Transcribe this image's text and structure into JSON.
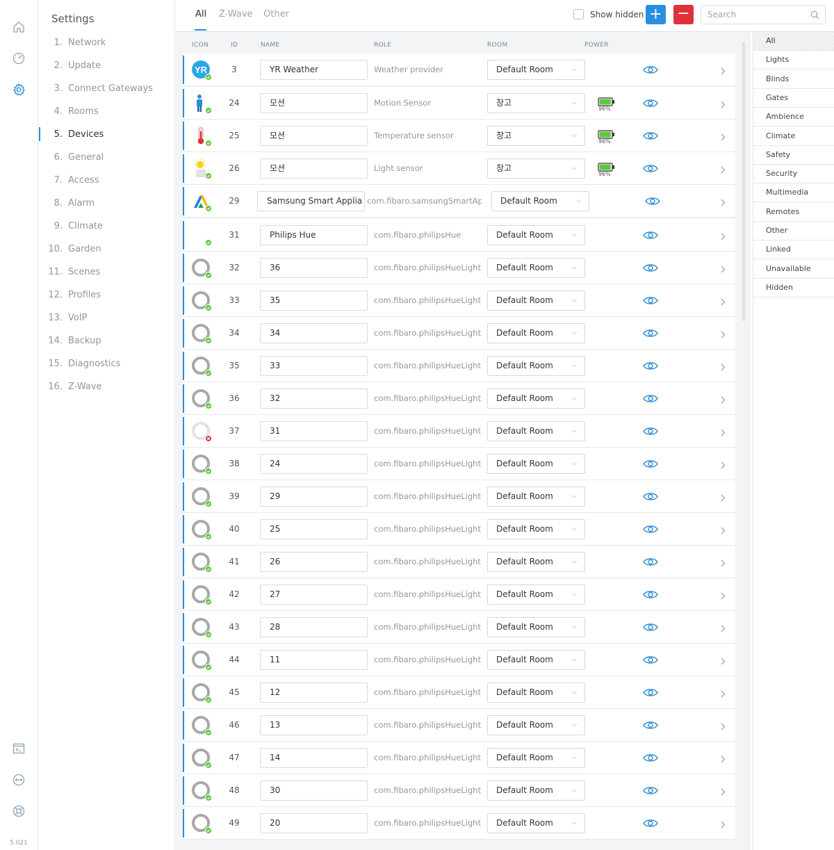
{
  "version": "5.021",
  "sidebar": {
    "title": "Settings",
    "items": [
      {
        "num": "1.",
        "label": "Network"
      },
      {
        "num": "2.",
        "label": "Update"
      },
      {
        "num": "3.",
        "label": "Connect Gateways"
      },
      {
        "num": "4.",
        "label": "Rooms"
      },
      {
        "num": "5.",
        "label": "Devices",
        "active": true
      },
      {
        "num": "6.",
        "label": "General"
      },
      {
        "num": "7.",
        "label": "Access"
      },
      {
        "num": "8.",
        "label": "Alarm"
      },
      {
        "num": "9.",
        "label": "Climate"
      },
      {
        "num": "10.",
        "label": "Garden"
      },
      {
        "num": "11.",
        "label": "Scenes"
      },
      {
        "num": "12.",
        "label": "Profiles"
      },
      {
        "num": "13.",
        "label": "VoIP"
      },
      {
        "num": "14.",
        "label": "Backup"
      },
      {
        "num": "15.",
        "label": "Diagnostics"
      },
      {
        "num": "16.",
        "label": "Z-Wave"
      }
    ]
  },
  "tabs": [
    "All",
    "Z-Wave",
    "Other"
  ],
  "active_tab": "All",
  "toolbar": {
    "show_hidden_label": "Show hidden",
    "add_label": "+",
    "remove_label": "−",
    "search_placeholder": "Search"
  },
  "columns": {
    "icon": "ICON",
    "id": "ID",
    "name": "NAME",
    "role": "ROLE",
    "room": "ROOM",
    "power": "POWER"
  },
  "colors": {
    "accent": "#2d8ad6",
    "add": "#2a8ee0",
    "remove": "#e0303c",
    "ok": "#5cc93a",
    "error": "#e03040"
  },
  "devices": [
    {
      "id": "3",
      "name": "YR Weather",
      "role": "Weather provider",
      "room": "Default Room",
      "icon": "yr-weather-icon",
      "status": "ok"
    },
    {
      "id": "24",
      "name": "모션",
      "role": "Motion Sensor",
      "room": "창고",
      "icon": "motion-sensor-icon",
      "status": "ok",
      "battery": "96%",
      "battery_level": 0.96
    },
    {
      "id": "25",
      "name": "모션",
      "role": "Temperature sensor",
      "room": "창고",
      "icon": "thermometer-icon",
      "status": "ok",
      "battery": "96%",
      "battery_level": 0.96
    },
    {
      "id": "26",
      "name": "모션",
      "role": "Light sensor",
      "room": "창고",
      "icon": "light-sensor-icon",
      "status": "ok",
      "battery": "96%",
      "battery_level": 0.96
    },
    {
      "id": "29",
      "name": "Samsung Smart Applia",
      "role": "com.fibaro.samsungSmartApplian",
      "room": "Default Room",
      "icon": "samsung-smartthings-icon",
      "status": "ok",
      "wide": true
    },
    {
      "id": "31",
      "name": "Philips Hue",
      "role": "com.fibaro.philipsHue",
      "room": "Default Room",
      "icon": "philips-hue-icon",
      "status": "ok"
    },
    {
      "id": "32",
      "name": "36",
      "role": "com.fibaro.philipsHueLight",
      "room": "Default Room",
      "icon": "hue-light-icon",
      "status": "ok"
    },
    {
      "id": "33",
      "name": "35",
      "role": "com.fibaro.philipsHueLight",
      "room": "Default Room",
      "icon": "hue-light-icon",
      "status": "ok"
    },
    {
      "id": "34",
      "name": "34",
      "role": "com.fibaro.philipsHueLight",
      "room": "Default Room",
      "icon": "hue-light-icon",
      "status": "ok"
    },
    {
      "id": "35",
      "name": "33",
      "role": "com.fibaro.philipsHueLight",
      "room": "Default Room",
      "icon": "hue-light-icon",
      "status": "ok"
    },
    {
      "id": "36",
      "name": "32",
      "role": "com.fibaro.philipsHueLight",
      "room": "Default Room",
      "icon": "hue-light-icon",
      "status": "ok"
    },
    {
      "id": "37",
      "name": "31",
      "role": "com.fibaro.philipsHueLight",
      "room": "Default Room",
      "icon": "hue-light-icon",
      "status": "error"
    },
    {
      "id": "38",
      "name": "24",
      "role": "com.fibaro.philipsHueLight",
      "room": "Default Room",
      "icon": "hue-light-icon",
      "status": "ok"
    },
    {
      "id": "39",
      "name": "29",
      "role": "com.fibaro.philipsHueLight",
      "room": "Default Room",
      "icon": "hue-light-icon",
      "status": "ok"
    },
    {
      "id": "40",
      "name": "25",
      "role": "com.fibaro.philipsHueLight",
      "room": "Default Room",
      "icon": "hue-light-icon",
      "status": "ok"
    },
    {
      "id": "41",
      "name": "26",
      "role": "com.fibaro.philipsHueLight",
      "room": "Default Room",
      "icon": "hue-light-icon",
      "status": "ok"
    },
    {
      "id": "42",
      "name": "27",
      "role": "com.fibaro.philipsHueLight",
      "room": "Default Room",
      "icon": "hue-light-icon",
      "status": "ok"
    },
    {
      "id": "43",
      "name": "28",
      "role": "com.fibaro.philipsHueLight",
      "room": "Default Room",
      "icon": "hue-light-icon",
      "status": "ok"
    },
    {
      "id": "44",
      "name": "11",
      "role": "com.fibaro.philipsHueLight",
      "room": "Default Room",
      "icon": "hue-light-icon",
      "status": "ok"
    },
    {
      "id": "45",
      "name": "12",
      "role": "com.fibaro.philipsHueLight",
      "room": "Default Room",
      "icon": "hue-light-icon",
      "status": "ok"
    },
    {
      "id": "46",
      "name": "13",
      "role": "com.fibaro.philipsHueLight",
      "room": "Default Room",
      "icon": "hue-light-icon",
      "status": "ok"
    },
    {
      "id": "47",
      "name": "14",
      "role": "com.fibaro.philipsHueLight",
      "room": "Default Room",
      "icon": "hue-light-icon",
      "status": "ok"
    },
    {
      "id": "48",
      "name": "30",
      "role": "com.fibaro.philipsHueLight",
      "room": "Default Room",
      "icon": "hue-light-icon",
      "status": "ok"
    },
    {
      "id": "49",
      "name": "20",
      "role": "com.fibaro.philipsHueLight",
      "room": "Default Room",
      "icon": "hue-light-icon",
      "status": "ok"
    }
  ],
  "filters": [
    "All",
    "Lights",
    "Blinds",
    "Gates",
    "Ambience",
    "Climate",
    "Safety",
    "Security",
    "Multimedia",
    "Remotes",
    "Other",
    "Linked",
    "Unavailable",
    "Hidden"
  ],
  "active_filter": "All"
}
